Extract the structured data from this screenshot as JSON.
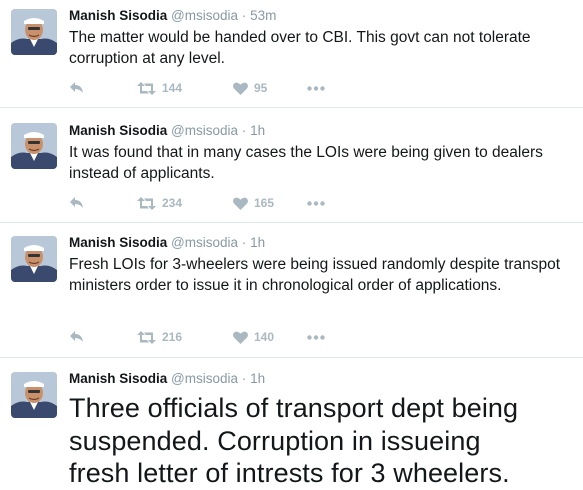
{
  "tweets": [
    {
      "name": "Manish Sisodia",
      "handle": "@msisodia",
      "separator": "·",
      "time": "53m",
      "text": "The matter would be handed over to CBI. This govt can not tolerate corruption at any level.",
      "retweets": "144",
      "likes": "95"
    },
    {
      "name": "Manish Sisodia",
      "handle": "@msisodia",
      "separator": "·",
      "time": "1h",
      "text": "It was found that in many cases the LOIs were being given to dealers instead of applicants.",
      "retweets": "234",
      "likes": "165"
    },
    {
      "name": "Manish Sisodia",
      "handle": "@msisodia",
      "separator": "·",
      "time": "1h",
      "text": "Fresh LOIs for 3-wheelers were being issued randomly despite transpot ministers order to issue it in chronological order of applications.",
      "retweets": "216",
      "likes": "140"
    },
    {
      "name": "Manish Sisodia",
      "handle": "@msisodia",
      "separator": "·",
      "time": "1h",
      "text": "Three officials of transport dept being suspended. Corruption in issueing fresh letter of intrests for 3 wheelers."
    }
  ],
  "icons": {
    "reply": "reply-icon",
    "retweet": "retweet-icon",
    "like": "heart-icon",
    "more": "more-icon"
  },
  "colors": {
    "icon_gray": "#aab8c2",
    "muted_text": "#8899a6",
    "divider": "#e1e8ed"
  }
}
